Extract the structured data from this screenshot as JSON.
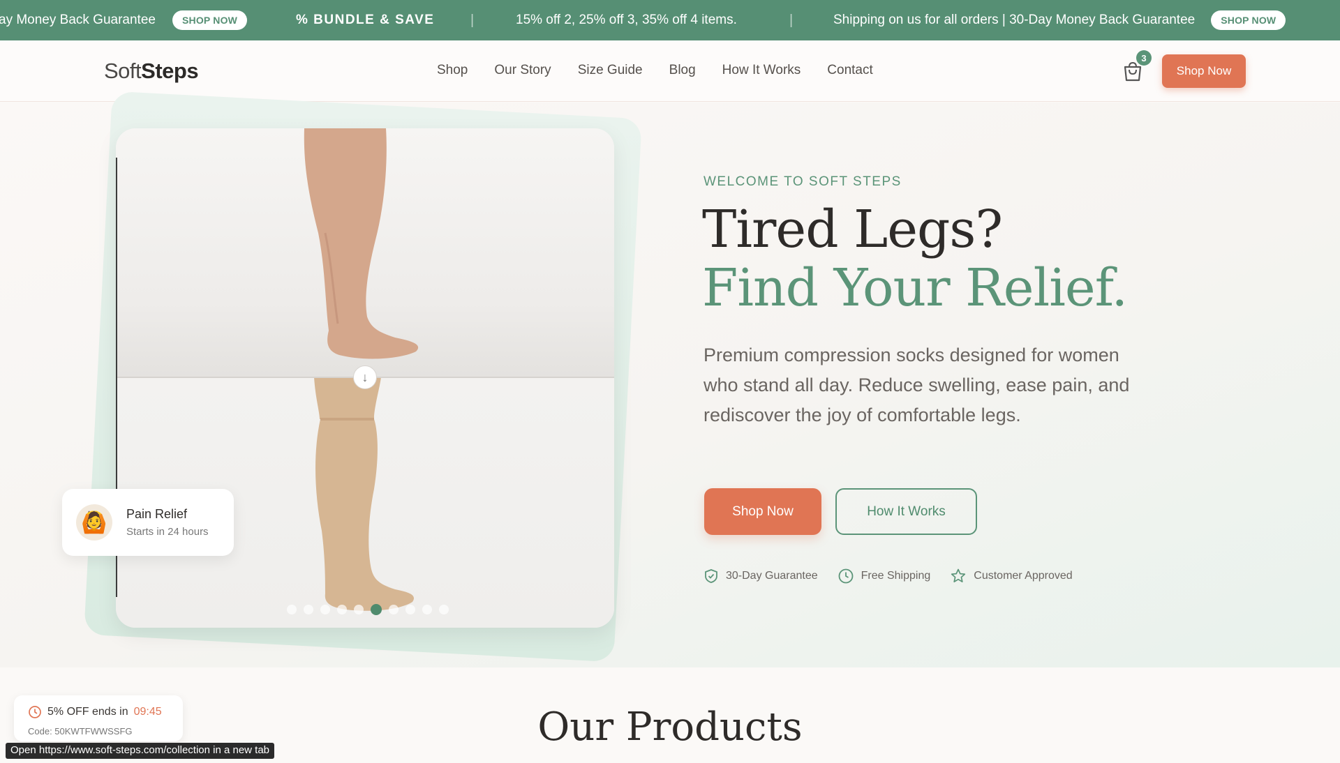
{
  "announcement": {
    "left_text": "ay Money Back Guarantee",
    "left_button": "SHOP NOW",
    "bundle_icon": "percent-icon",
    "bundle_label": "% BUNDLE & SAVE",
    "offer_text": "15% off 2, 25% off 3, 35% off 4 items.",
    "shipping_text": "Shipping on us for all orders | 30-Day Money Back Guarantee",
    "right_button": "SHOP NOW",
    "background": "#568f74"
  },
  "header": {
    "logo_soft": "Soft",
    "logo_steps": "Steps",
    "nav": [
      "Shop",
      "Our Story",
      "Size Guide",
      "Blog",
      "How It Works",
      "Contact"
    ],
    "cart_icon": "shopping-bag-icon",
    "cart_count": "3",
    "cta": "Shop Now"
  },
  "hero": {
    "eyebrow": "WELCOME TO SOFT STEPS",
    "headline_line1": "Tired Legs?",
    "headline_line2": "Find Your Relief.",
    "description": "Premium compression socks designed for women who stand all day. Reduce swelling, ease pain, and rediscover the joy of comfortable legs.",
    "primary_cta": "Shop Now",
    "secondary_cta": "How It Works",
    "trust": [
      {
        "icon": "shield-check-icon",
        "label": "30-Day Guarantee"
      },
      {
        "icon": "clock-icon",
        "label": "Free Shipping"
      },
      {
        "icon": "star-icon",
        "label": "Customer Approved"
      }
    ],
    "badge": {
      "title": "Pain Relief",
      "subtitle": "Starts in 24 hours",
      "avatar_icon": "person-emoji-icon"
    },
    "carousel_active_index": 5,
    "carousel_count": 10,
    "accent": "#5b9478",
    "cta_color": "#e07554"
  },
  "products": {
    "title": "Our Products"
  },
  "timer": {
    "label": "5% OFF ends in",
    "countdown": "09:45",
    "code": "Code: 50KWTFWWSSFG"
  },
  "status_bar": {
    "prefix": "Open",
    "url": "https://www.soft-steps.com/collection",
    "suffix": "in a new tab"
  }
}
